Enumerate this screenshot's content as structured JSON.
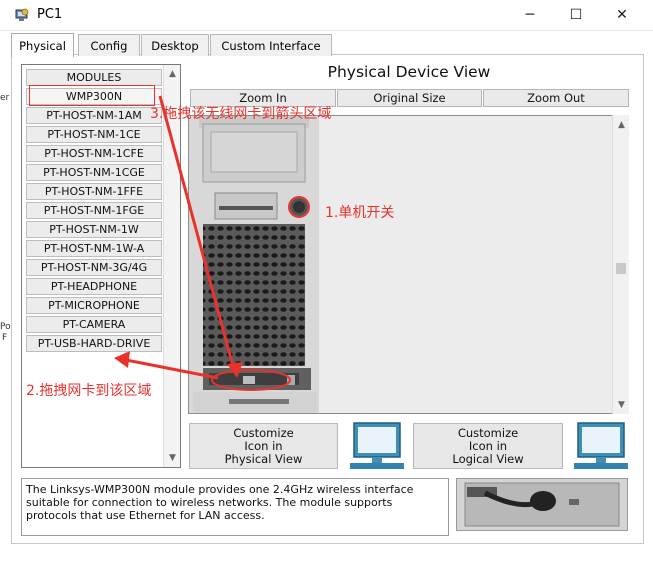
{
  "window": {
    "title": "PC1",
    "minimize_glyph": "─",
    "maximize_glyph": "☐",
    "close_glyph": "✕"
  },
  "tabs": [
    {
      "label": "Physical",
      "active": true
    },
    {
      "label": "Config",
      "active": false
    },
    {
      "label": "Desktop",
      "active": false
    },
    {
      "label": "Custom Interface",
      "active": false
    }
  ],
  "modules": {
    "items": [
      "MODULES",
      "WMP300N",
      "PT-HOST-NM-1AM",
      "PT-HOST-NM-1CE",
      "PT-HOST-NM-1CFE",
      "PT-HOST-NM-1CGE",
      "PT-HOST-NM-1FFE",
      "PT-HOST-NM-1FGE",
      "PT-HOST-NM-1W",
      "PT-HOST-NM-1W-A",
      "PT-HOST-NM-3G/4G",
      "PT-HEADPHONE",
      "PT-MICROPHONE",
      "PT-CAMERA",
      "PT-USB-HARD-DRIVE"
    ],
    "selected": "WMP300N"
  },
  "physical_view": {
    "title": "Physical Device View",
    "zoom_in": "Zoom In",
    "original_size": "Original Size",
    "zoom_out": "Zoom Out"
  },
  "customize": {
    "physical": {
      "line1": "Customize",
      "line2": "Icon in",
      "line3": "Physical View"
    },
    "logical": {
      "line1": "Customize",
      "line2": "Icon in",
      "line3": "Logical View"
    }
  },
  "description": "The Linksys-WMP300N module provides one 2.4GHz wireless interface suitable for connection to wireless networks. The module supports protocols that use Ethernet for LAN access.",
  "annotations": {
    "step1": "1.单机开关",
    "step2": "2.拖拽网卡到该区域",
    "step3": "3.拖拽该无线网卡到箭头区域",
    "color": "#e8322e"
  },
  "scroll_arrows": {
    "up": "▲",
    "down": "▼"
  },
  "side_strip_text": {
    "top": "er",
    "mid": "Po",
    "bot": "F"
  }
}
